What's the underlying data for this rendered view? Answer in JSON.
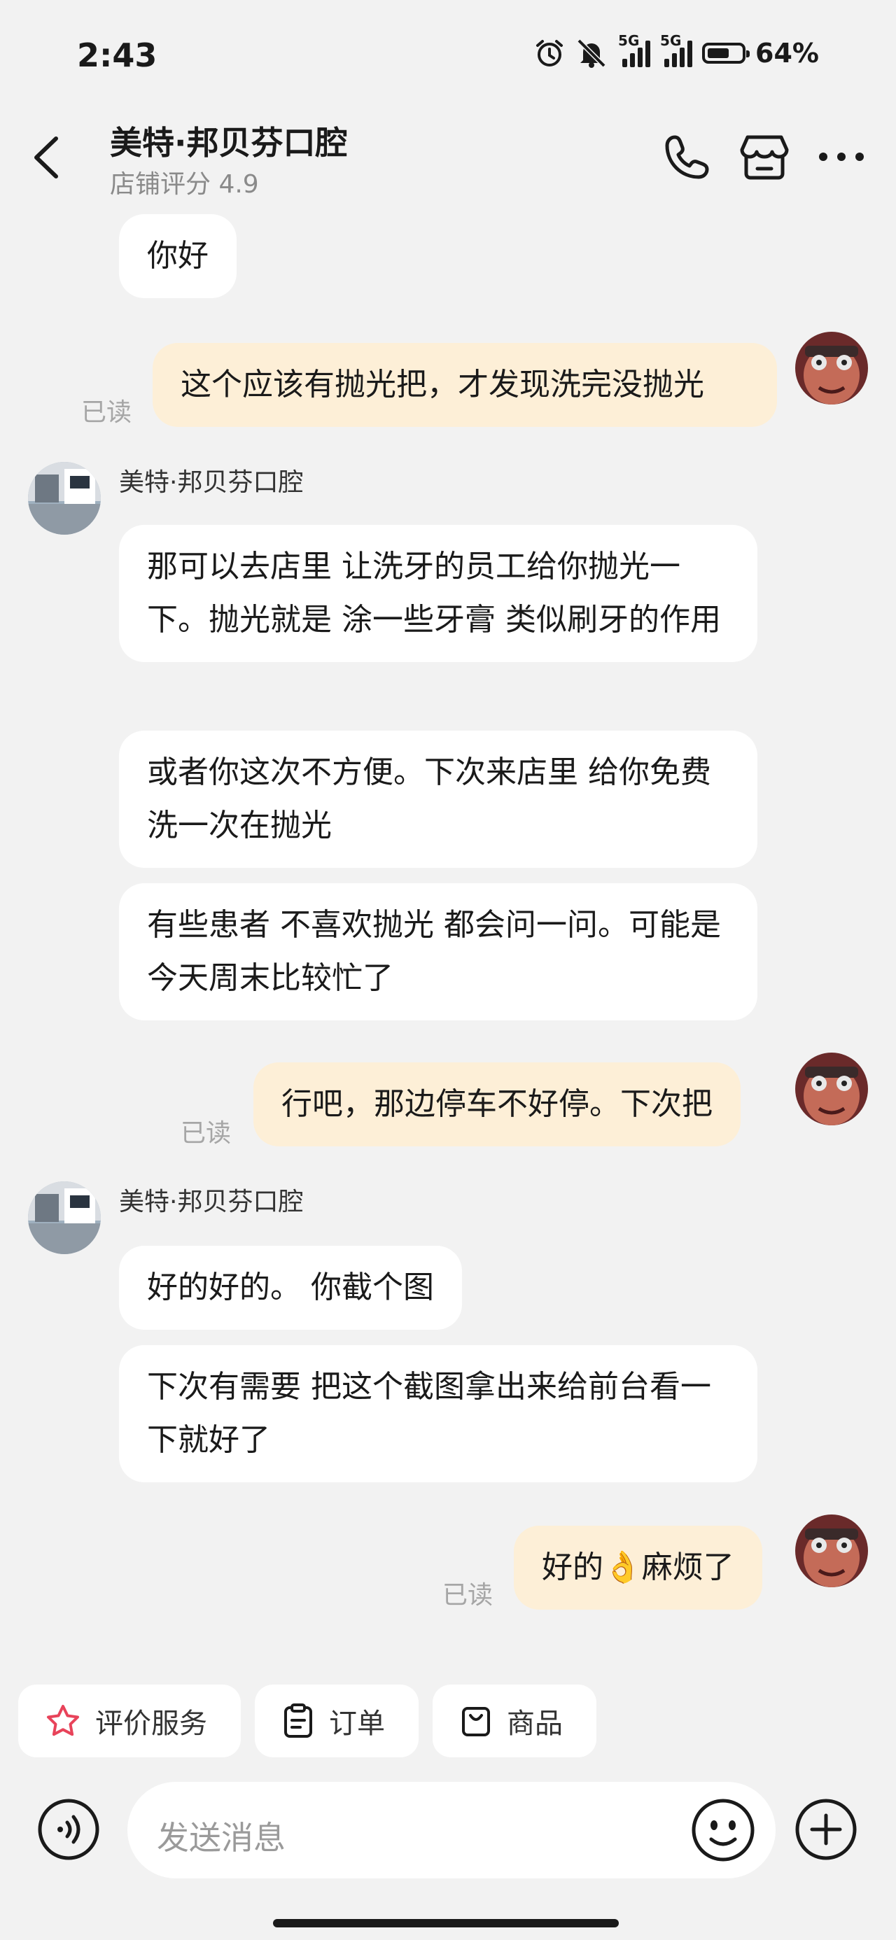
{
  "status": {
    "time": "2:43",
    "net1": "5G",
    "net2": "5G",
    "battery": "64%",
    "battery_level": 0.64
  },
  "header": {
    "title": "美特·邦贝芬口腔",
    "subtitle": "店铺评分 4.9",
    "icons": [
      "back-icon",
      "phone-icon",
      "store-icon",
      "more-icon"
    ]
  },
  "chat": {
    "read_label": "已读",
    "sender": "美特·邦贝芬口腔",
    "msg1": "你好",
    "msg2": "这个应该有抛光把，才发现洗完没抛光",
    "msg3": "那可以去店里 让洗牙的员工给你抛光一下。抛光就是 涂一些牙膏 类似刷牙的作用",
    "msg4": "或者你这次不方便。下次来店里 给你免费洗一次在抛光",
    "msg5": "有些患者 不喜欢抛光 都会问一问。可能是今天周末比较忙了",
    "msg6": "行吧，那边停车不好停。下次把",
    "msg7": "好的好的。 你截个图",
    "msg8": "下次有需要 把这个截图拿出来给前台看一下就好了",
    "msg9": "好的👌麻烦了"
  },
  "quick_actions": {
    "review": "评价服务",
    "order": "订单",
    "goods": "商品"
  },
  "input": {
    "placeholder": "发送消息"
  },
  "colors": {
    "outgoing_bubble": "#fdefd7",
    "incoming_bubble": "#ffffff",
    "background": "#f2f2f2",
    "star": "#e8435a"
  }
}
